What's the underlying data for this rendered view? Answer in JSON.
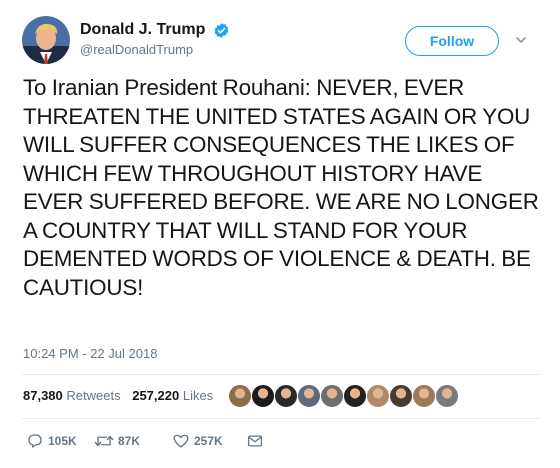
{
  "tweet": {
    "author": {
      "display_name": "Donald J. Trump",
      "handle": "@realDonaldTrump",
      "verified": true,
      "avatar_icon": "profile-photo"
    },
    "follow_label": "Follow",
    "text": "To Iranian President Rouhani: NEVER, EVER THREATEN THE UNITED STATES AGAIN OR YOU WILL SUFFER CONSEQUENCES THE LIKES OF WHICH FEW THROUGHOUT HISTORY HAVE EVER SUFFERED BEFORE. WE ARE NO LONGER A COUNTRY THAT WILL STAND FOR YOUR DEMENTED WORDS OF VIOLENCE & DEATH. BE CAUTIOUS!",
    "timestamp": "10:24 PM - 22 Jul 2018",
    "stats": {
      "retweets_count": "87,380",
      "retweets_label": "Retweets",
      "likes_count": "257,220",
      "likes_label": "Likes"
    },
    "liker_avatars": [
      {
        "color": "#8a6d4b"
      },
      {
        "color": "#1b1b1b"
      },
      {
        "color": "#2a2a2a"
      },
      {
        "color": "#5b6b7a"
      },
      {
        "color": "#6e6e6e"
      },
      {
        "color": "#222222"
      },
      {
        "color": "#b08968"
      },
      {
        "color": "#4a3b2f"
      },
      {
        "color": "#9c7b5c"
      },
      {
        "color": "#7a7a7a"
      }
    ],
    "actions": {
      "reply_count": "105K",
      "retweet_count": "87K",
      "like_count": "257K"
    },
    "colors": {
      "accent": "#1da1f2",
      "secondary_text": "#657786",
      "primary_text": "#14171a",
      "divider": "#e6ecf0"
    }
  }
}
